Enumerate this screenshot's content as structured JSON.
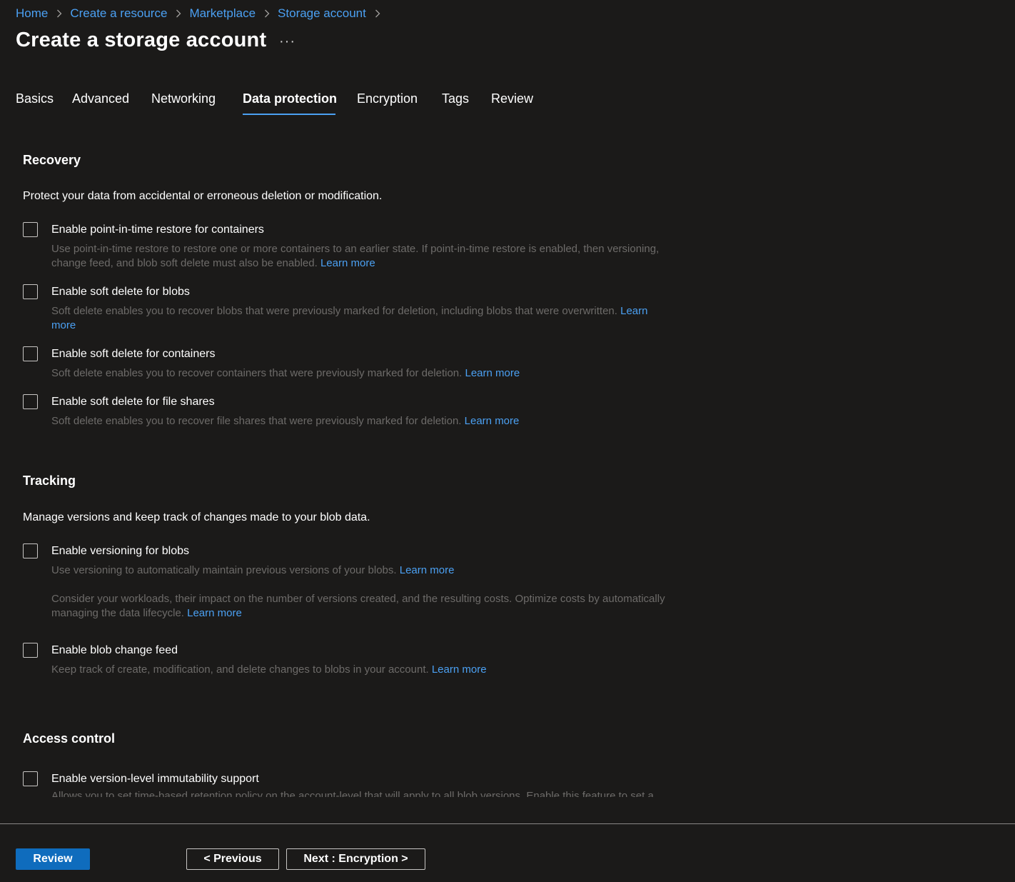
{
  "breadcrumb": [
    "Home",
    "Create a resource",
    "Marketplace",
    "Storage account"
  ],
  "title": "Create a storage account",
  "more_label": "···",
  "tabs": [
    "Basics",
    "Advanced",
    "Networking",
    "Data protection",
    "Encryption",
    "Tags",
    "Review"
  ],
  "active_tab": "Data protection",
  "recovery": {
    "heading": "Recovery",
    "description": "Protect your data from accidental or erroneous deletion or modification.",
    "options": [
      {
        "label": "Enable point-in-time restore for containers",
        "checked": false,
        "help": "Use point-in-time restore to restore one or more containers to an earlier state. If point-in-time restore is enabled, then versioning, change feed, and blob soft delete must also be enabled.",
        "link": "Learn more"
      },
      {
        "label": "Enable soft delete for blobs",
        "checked": false,
        "help": "Soft delete enables you to recover blobs that were previously marked for deletion, including blobs that were overwritten.",
        "link": "Learn more"
      },
      {
        "label": "Enable soft delete for containers",
        "checked": false,
        "help": "Soft delete enables you to recover containers that were previously marked for deletion.",
        "link": "Learn more"
      },
      {
        "label": "Enable soft delete for file shares",
        "checked": false,
        "help": "Soft delete enables you to recover file shares that were previously marked for deletion.",
        "link": "Learn more"
      }
    ]
  },
  "tracking": {
    "heading": "Tracking",
    "description": "Manage versions and keep track of changes made to your blob data.",
    "options": [
      {
        "label": "Enable versioning for blobs",
        "checked": false,
        "help": "Use versioning to automatically maintain previous versions of your blobs.",
        "link": "Learn more",
        "help2": "Consider your workloads, their impact on the number of versions created, and the resulting costs. Optimize costs by automatically managing the data lifecycle.",
        "link2": "Learn more"
      },
      {
        "label": "Enable blob change feed",
        "checked": false,
        "help": "Keep track of create, modification, and delete changes to blobs in your account.",
        "link": "Learn more"
      }
    ]
  },
  "access_control": {
    "heading": "Access control",
    "options": [
      {
        "label": "Enable version-level immutability support",
        "checked": false,
        "help": "Allows you to set time-based retention policy on the account-level that will apply to all blob versions. Enable this feature to set a"
      }
    ]
  },
  "footer": {
    "review": "Review",
    "previous": "< Previous",
    "next": "Next : Encryption >"
  },
  "colors": {
    "accent": "#4ba0f2",
    "primary_button": "#0f6cbd",
    "background": "#1b1a19",
    "muted_text": "#6d6b69"
  }
}
